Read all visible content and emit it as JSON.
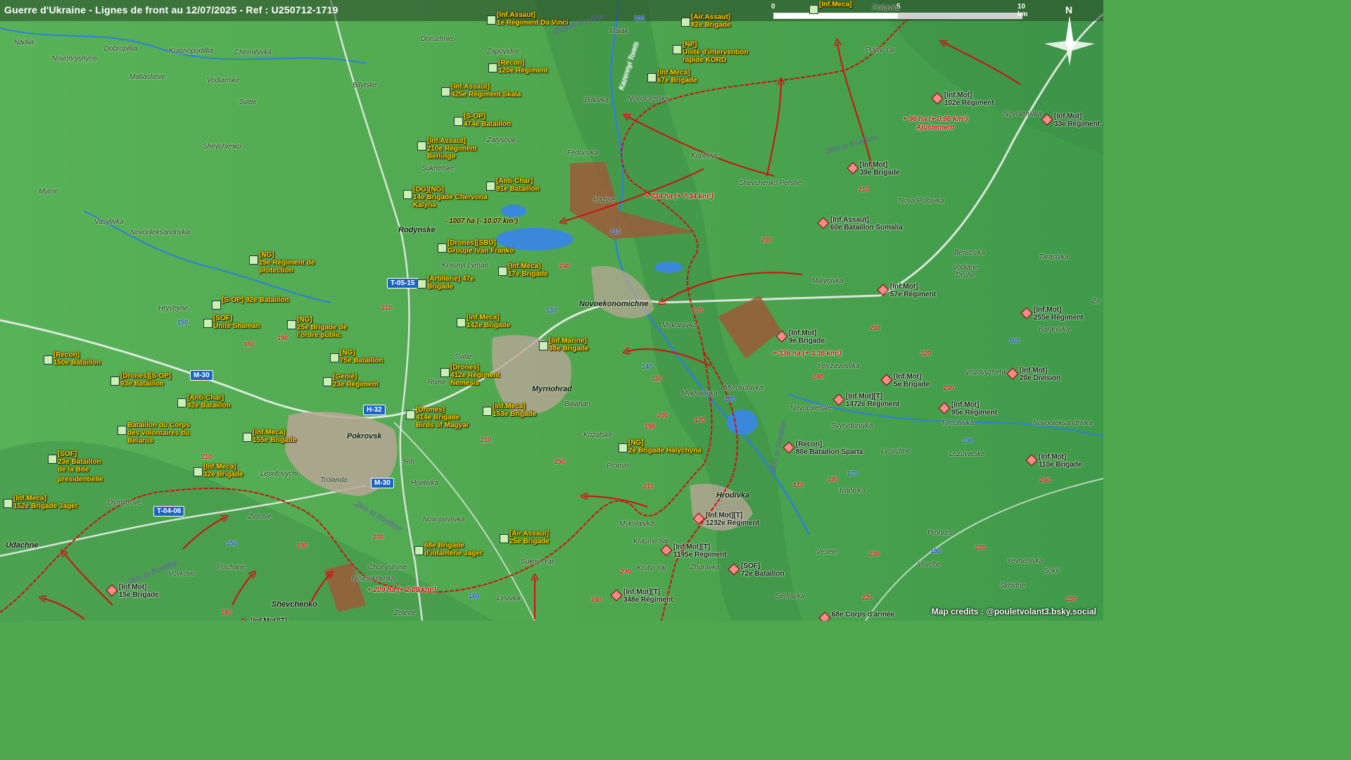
{
  "title": "Guerre d'Ukraine - Lignes de front au 12/07/2025 - Ref : U250712-1719",
  "scale": {
    "zero": "0",
    "mid": "5",
    "end": "10 km"
  },
  "north": "N",
  "credit": "Map credits : @pouletvolant3.bsky.social",
  "colors": {
    "ukr_units": "#ffd400",
    "front_line": "#d01010",
    "land": "#4fa84f",
    "road_shield": "#1e63c4"
  },
  "places": {
    "nadiia": "Nadiia",
    "dobropillia": "Dobropillia",
    "krasnopodillia": "Krasnopodillia",
    "chernihivka": "Chernihivka",
    "novohryshyne": "Novohryshyne",
    "matiasheve": "Matiasheve",
    "vodianske": "Vodianske",
    "svitle1": "Svitle",
    "shevchenko1": "Shevchenko",
    "myrne": "Myrne",
    "vasylivka": "Vasylivka",
    "novooleksandrivka1": "Novooleksandrivka",
    "hryshyne": "Hryshyne",
    "dorozhnie": "Dorozhnie",
    "zapovidne": "Zapovidne",
    "bilytske": "Bilytske",
    "zatyshok": "Zatyshok",
    "sukhetske": "Sukhetske",
    "rodynske": "Rodynske",
    "krasnyi_lyman": "Krasnyi Lyman",
    "svitle2": "Svitle",
    "rivne": "Rivne",
    "myrnohrad": "Myrnohrad",
    "balahan": "Balahan",
    "kozatske": "Kozatske",
    "promin": "Promin",
    "pokrovsk": "Pokrovsk",
    "leontovychi": "Leontovychi",
    "troianda": "Troianda",
    "rih": "Rih",
    "hnativka": "Hnativka",
    "novopavlivka": "Novopavlivka",
    "dymytrove": "Dymytrove",
    "zvirove": "Zvirove",
    "udachne": "Udachne",
    "vovkove": "Vovkove",
    "pischane": "Pischane",
    "novoukrainka": "Novoukrainka",
    "chunyshyne": "Chunyshyne",
    "sukhyi_yar": "Sukhyi Yar",
    "lysivka": "Lysivka",
    "zelene": "Zelene",
    "shevchenko2": "Shevchenko",
    "maiak": "Maiak",
    "bilkivka": "Bilkivka",
    "novotoretske1": "Novotoretske",
    "fedorivka": "Fedorivka",
    "razine": "Razine",
    "koptieve": "Koptieve",
    "shevchenko_pershe": "Shevchenko Pershe",
    "novoekonomichne": "Novoekonomichne",
    "mykolaivka1": "Mykolaivka",
    "mykhailivka": "Mykhailivka",
    "myroliubivka": "Myroliubivka",
    "malynivka": "Malynivka",
    "hrodivka": "Hrodivka",
    "mykolaivka2": "Mykolaivka",
    "krasnyi_yar": "Krasnyi Yar",
    "krutyi_yar": "Krutyi Yar",
    "zhuravka": "Zhuravka",
    "serhiivka": "Serhiivka",
    "vesele": "Vesele",
    "novotoretske2": "Novotoretske",
    "yelyzavetivka": "Yelyzavetivka",
    "svyrydonivka": "Svyrydonivka",
    "lysychne": "Lysychne",
    "ivanivka": "Ivanivka",
    "popiv_yar": "Popiv Yar",
    "poltavka": "Poltavka",
    "novolenivka": "Novolenivka",
    "nova_poltavka": "Nova Poltavka",
    "berezivka": "Berezivka",
    "vodiane_druhe": "Vodiane Druhe",
    "tarasivka": "Tarasivka",
    "baranivka": "Baranivka",
    "vozdvyzhenka": "Vozdvyzhenka",
    "tymofiivka": "Tymofiivka",
    "lozuvatske": "Lozuvatske",
    "novooleksandrivka2": "Novooleksandrivka",
    "prohres": "Prohres",
    "vovche": "Vovche",
    "yevhenivka": "Yevhenivka",
    "sokil": "Sokil",
    "skhidne": "Skhidne",
    "kazennyi_torets": "Kazennyi Torets",
    "ze": "Ze"
  },
  "roads": {
    "t0515": "T-05-15",
    "m30a": "M-30",
    "h32": "H-32",
    "m30b": "M-30",
    "t0406": "T-04-06"
  },
  "frontline_notes": {
    "a": "2km to frontline",
    "b": "2km to frontline",
    "c": "2km to frontline",
    "d": "2km to frontline",
    "e": "2km to frontline"
  },
  "area_changes": {
    "loss_1007": "- 1007 ha (- 10.07 km²)",
    "gain_734": "+ 734 ha (+ 7.34 km²)",
    "gain_336": "+ 336 ha (+ 3.36 km²)",
    "gain_209": "+ 209 ha (+ 2.09 km²)",
    "gain_96": "+ 96 ha (+ 0.96 km²)",
    "gain_96_note": "Ajustement"
  },
  "ukr_units": [
    {
      "l1": "[Inf.Assaut]",
      "l2": "1e Régiment Da Vinci",
      "l3": ""
    },
    {
      "l1": "[Air.Assaut]",
      "l2": "82e Brigade",
      "l3": ""
    },
    {
      "l1": "[NP]",
      "l2": "Unité d'intervention",
      "l3": "rapide KORD"
    },
    {
      "l1": "[Recon]",
      "l2": "120e Régiment",
      "l3": ""
    },
    {
      "l1": "[Inf.Meca]",
      "l2": "67e Brigade",
      "l3": ""
    },
    {
      "l1": "[Inf.Assaut]",
      "l2": "425e Régiment Skala",
      "l3": ""
    },
    {
      "l1": "[S-OP]",
      "l2": "474e Bataillon",
      "l3": ""
    },
    {
      "l1": "[Inf.Assaut]",
      "l2": "210e Régiment",
      "l3": "Berlingo"
    },
    {
      "l1": "[Anti-Char]",
      "l2": "91e Bataillon",
      "l3": ""
    },
    {
      "l1": "[OG][NG]",
      "l2": "14e Brigade Chervona",
      "l3": "Kalyna"
    },
    {
      "l1": "[Drones][SBU]",
      "l2": "Groupe Ivan Franko",
      "l3": ""
    },
    {
      "l1": "[NG]",
      "l2": "29e Régiment de",
      "l3": "protection"
    },
    {
      "l1": "[Inf.Meca]",
      "l2": "17e Brigade",
      "l3": ""
    },
    {
      "l1": "[Artillerie] 47e",
      "l2": "Brigade",
      "l3": ""
    },
    {
      "l1": "[S-OP] 92e Bataillon",
      "l2": "",
      "l3": ""
    },
    {
      "l1": "[SOF]",
      "l2": "Unité Shaman",
      "l3": ""
    },
    {
      "l1": "[NG]",
      "l2": "25e Brigade de",
      "l3": "l'ordre public"
    },
    {
      "l1": "[Inf.Meca]",
      "l2": "142e Brigade",
      "l3": ""
    },
    {
      "l1": "[Inf.Marine]",
      "l2": "38e Brigade",
      "l3": ""
    },
    {
      "l1": "[Recon]",
      "l2": "150e Bataillon",
      "l3": ""
    },
    {
      "l1": "[NG]",
      "l2": "75e Bataillon",
      "l3": ""
    },
    {
      "l1": "[Drones][S-OP]",
      "l2": "93e Bataillon",
      "l3": ""
    },
    {
      "l1": "[Génie]",
      "l2": "23e Régiment",
      "l3": ""
    },
    {
      "l1": "[Drones]",
      "l2": "412e Régiment",
      "l3": "Nemesis"
    },
    {
      "l1": "[Anti-Char]",
      "l2": "92e Bataillon",
      "l3": ""
    },
    {
      "l1": "[Drones]",
      "l2": "414e Brigade",
      "l3": "Birds of Magyar"
    },
    {
      "l1": "[Inf.Meca]",
      "l2": "153e Brigade",
      "l3": ""
    },
    {
      "l1": "Bataillon du Corps",
      "l2": "des volontaires du",
      "l3": "Belarus"
    },
    {
      "l1": "[Inf.Meca]",
      "l2": "155e Brigade",
      "l3": ""
    },
    {
      "l1": "[NG]",
      "l2": "2e Brigade Halychyna",
      "l3": ""
    },
    {
      "l1": "[SOF]",
      "l2": "23e Bataillon",
      "l3": "de la Bde"
    },
    {
      "l1": "[Inf.Meca]",
      "l2": "32e Brigade",
      "l3": ""
    },
    {
      "l1": "[Inf.Meca]",
      "l2": "152e Brigade Jager",
      "l3": ""
    },
    {
      "l1": "[Air.Assaut]",
      "l2": "25e Brigade",
      "l3": ""
    },
    {
      "l1": "68e Brigade",
      "l2": "d'infanterie Jager",
      "l3": ""
    },
    {
      "l1": "[Inf.Meca]",
      "l2": "",
      "l3": ""
    }
  ],
  "sof_extra": "présidentielle",
  "rus_units": [
    {
      "l1": "[Inf.Mot]",
      "l2": "102e Régiment"
    },
    {
      "l1": "[Inf.Mot]",
      "l2": "33e Régiment"
    },
    {
      "l1": "[Inf.Mot]",
      "l2": "39e Brigade"
    },
    {
      "l1": "[Inf.Assaut]",
      "l2": "60e Bataillon Somalia"
    },
    {
      "l1": "[Inf.Mot]",
      "l2": "57e Régiment"
    },
    {
      "l1": "[Inf.Mot]",
      "l2": "9e Brigade"
    },
    {
      "l1": "[Inf.Mot]",
      "l2": "255e Régiment"
    },
    {
      "l1": "[Inf.Mot]",
      "l2": "5e Brigade"
    },
    {
      "l1": "[Inf.Mot][T]",
      "l2": "1472e Régiment"
    },
    {
      "l1": "[Inf.Mot]",
      "l2": "20e Division"
    },
    {
      "l1": "[Inf.Mot]",
      "l2": "95e Régiment"
    },
    {
      "l1": "[Recon]",
      "l2": "80e Bataillon Sparta"
    },
    {
      "l1": "[Inf.Mot]",
      "l2": "110e Brigade"
    },
    {
      "l1": "[Inf.Mot][T]",
      "l2": "1232e Régiment"
    },
    {
      "l1": "[Inf.Mot][T]",
      "l2": "1195e Régiment"
    },
    {
      "l1": "[SOF]",
      "l2": "72e Bataillon"
    },
    {
      "l1": "[Inf.Mot][T]",
      "l2": "348e Régiment"
    },
    {
      "l1": "[Inf.Mot]",
      "l2": "15e Brigade"
    },
    {
      "l1": "68e Corps d'armée",
      "l2": ""
    },
    {
      "l1": "[Inf.Mot][T]",
      "l2": ""
    }
  ],
  "road_numbers": [
    "100",
    "110",
    "240",
    "210",
    "150",
    "180",
    "190",
    "130",
    "190",
    "200",
    "170",
    "140",
    "160",
    "130",
    "170",
    "250",
    "210",
    "230",
    "240",
    "160",
    "200",
    "220",
    "230",
    "240",
    "170",
    "210",
    "170",
    "200",
    "190",
    "160",
    "230",
    "190",
    "240",
    "220",
    "220",
    "230",
    "190",
    "210",
    "150",
    "180",
    "200",
    "190",
    "210"
  ]
}
